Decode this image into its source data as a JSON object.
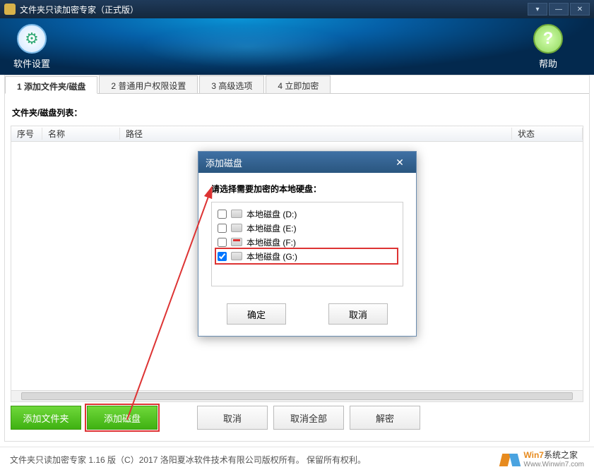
{
  "window": {
    "title": "文件夹只读加密专家（正式版）"
  },
  "ribbon": {
    "settings": "软件设置",
    "help": "帮助"
  },
  "tabs": {
    "t1": "1 添加文件夹/磁盘",
    "t2": "2 普通用户权限设置",
    "t3": "3 高级选项",
    "t4": "4 立即加密"
  },
  "list_label": "文件夹/磁盘列表：",
  "columns": {
    "seq": "序号",
    "name": "名称",
    "path": "路径",
    "status": "状态"
  },
  "buttons": {
    "add_folder": "添加文件夹",
    "add_disk": "添加磁盘",
    "cancel": "取消",
    "cancel_all": "取消全部",
    "decrypt": "解密"
  },
  "dialog": {
    "title": "添加磁盘",
    "prompt": "请选择需要加密的本地硬盘：",
    "drives": [
      {
        "label": "本地磁盘 (D:)",
        "checked": false
      },
      {
        "label": "本地磁盘 (E:)",
        "checked": false
      },
      {
        "label": "本地磁盘 (F:)",
        "checked": false
      },
      {
        "label": "本地磁盘 (G:)",
        "checked": true
      }
    ],
    "ok": "确定",
    "cancel": "取消"
  },
  "footer": {
    "copyright": "文件夹只读加密专家 1.16 版（C）2017 洛阳夏冰软件技术有限公司版权所有。 保留所有权利。"
  },
  "watermark": {
    "brand_prefix": "Win7",
    "brand_suffix": "系统之家",
    "url": "Www.Winwin7.com"
  }
}
